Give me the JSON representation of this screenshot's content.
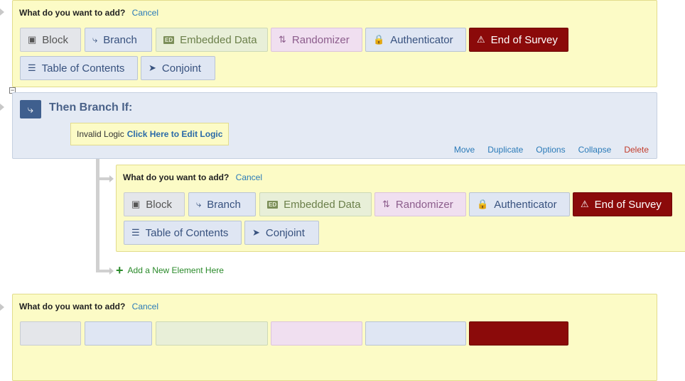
{
  "add_panel": {
    "question": "What do you want to add?",
    "cancel": "Cancel",
    "buttons": {
      "block": "Block",
      "branch": "Branch",
      "embedded_data": "Embedded Data",
      "randomizer": "Randomizer",
      "authenticator": "Authenticator",
      "end_of_survey": "End of Survey",
      "table_of_contents": "Table of Contents",
      "conjoint": "Conjoint"
    }
  },
  "branch": {
    "title": "Then Branch If:",
    "invalid_logic": "Invalid Logic",
    "edit_logic_link": "Click Here to Edit Logic",
    "actions": {
      "move": "Move",
      "duplicate": "Duplicate",
      "options": "Options",
      "collapse": "Collapse",
      "delete": "Delete"
    }
  },
  "add_new_element": "Add a New Element Here",
  "colors": {
    "add_panel_bg": "#fcfbc6",
    "branch_panel_bg": "#e4eaf4",
    "end_of_survey_bg": "#8b0a0a",
    "link": "#2a7ab8",
    "delete": "#c23b2a",
    "add_element": "#2a8a2a"
  }
}
